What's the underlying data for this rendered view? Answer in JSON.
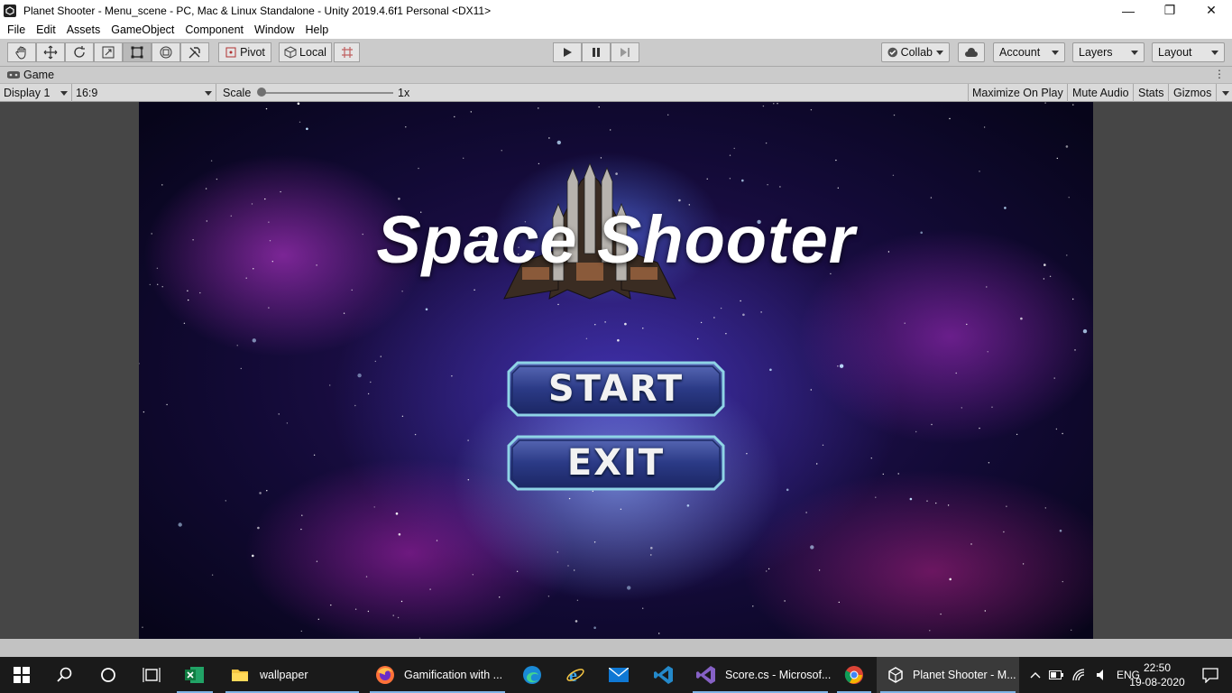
{
  "window": {
    "title": "Planet Shooter - Menu_scene - PC, Mac & Linux Standalone - Unity 2019.4.6f1 Personal <DX11>",
    "controls": [
      "—",
      "❐",
      "✕"
    ]
  },
  "menubar": {
    "items": [
      "File",
      "Edit",
      "Assets",
      "GameObject",
      "Component",
      "Window",
      "Help"
    ]
  },
  "toolbar": {
    "tools": [
      "hand-tool",
      "move-tool",
      "rotate-tool",
      "scale-tool",
      "rect-tool",
      "transform-tool",
      "custom-tool"
    ],
    "pivot_label": "Pivot",
    "local_label": "Local",
    "collab_label": "Collab",
    "account_label": "Account",
    "layers_label": "Layers",
    "layout_label": "Layout"
  },
  "game_tab": {
    "label": "Game"
  },
  "game_toolbar": {
    "display": "Display 1",
    "aspect": "16:9",
    "scale_label": "Scale",
    "scale_value": "1x",
    "scale_level": 0.0,
    "maximize_label": "Maximize On Play",
    "mute_label": "Mute Audio",
    "stats_label": "Stats",
    "gizmos_label": "Gizmos"
  },
  "game": {
    "title": "Space Shooter",
    "start_label": "START",
    "exit_label": "EXIT"
  },
  "taskbar": {
    "items": [
      {
        "icon": "windows-start-icon"
      },
      {
        "icon": "search-icon"
      },
      {
        "icon": "cortana-icon"
      },
      {
        "icon": "task-view-icon"
      },
      {
        "icon": "excel-icon"
      },
      {
        "icon": "folder-icon",
        "label": "wallpaper"
      },
      {
        "icon": "firefox-icon",
        "label": "Gamification with ..."
      },
      {
        "icon": "edge-icon"
      },
      {
        "icon": "ie-icon"
      },
      {
        "icon": "mail-icon"
      },
      {
        "icon": "vscode-icon"
      },
      {
        "icon": "visual-studio-icon",
        "label": "Score.cs - Microsof..."
      },
      {
        "icon": "chrome-icon"
      },
      {
        "icon": "unity-icon",
        "label": "Planet Shooter - M..."
      }
    ],
    "language": "ENG",
    "time": "22:50",
    "date": "19-08-2020"
  }
}
